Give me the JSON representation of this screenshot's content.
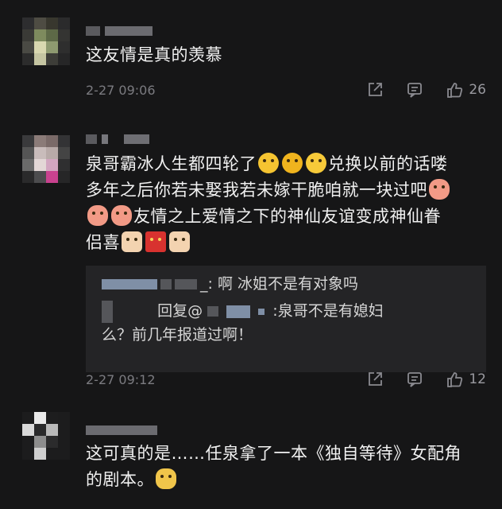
{
  "comments": [
    {
      "text": "这友情是真的羡慕",
      "time": "2-27 09:06",
      "likes": "26",
      "username_partial": "..."
    },
    {
      "text_line1": "泉哥霸冰人生都四轮了",
      "text_line1_after": "兑换以前的话喽",
      "text_line2": "多年之后你若未娶我若未嫁干脆咱就一块过吧",
      "text_line3": "友情之上爱情之下的神仙友谊变成神仙眷",
      "text_line4": "侣喜",
      "reply1": {
        "suffix": "_: 啊 冰姐不是有对象吗"
      },
      "reply2": {
        "prefix": "回复@",
        "suffix": ":泉哥不是有媳妇",
        "line2": "么？前几年报道过啊！"
      },
      "time": "2-27 09:12",
      "likes": "12"
    },
    {
      "text_line1": "这可真的是……任泉拿了一本《独自等待》女配角",
      "text_line2": "的剧本。"
    }
  ],
  "icons": [
    "share-icon",
    "comment-icon",
    "thumbs-up-icon"
  ]
}
